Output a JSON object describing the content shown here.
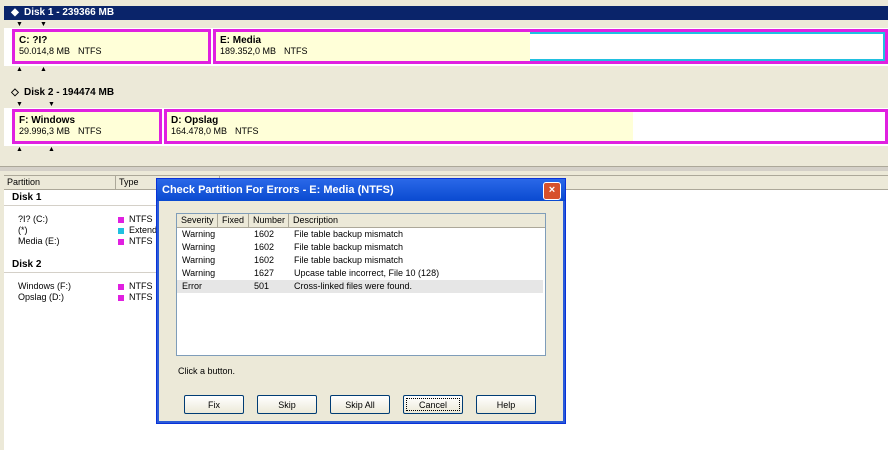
{
  "disk1": {
    "title": "Disk 1 - 239366 MB",
    "partitions": [
      {
        "name": "C:  ?I?",
        "size": "50.014,8 MB",
        "fs": "NTFS"
      },
      {
        "name": "E:  Media",
        "size": "189.352,0 MB",
        "fs": "NTFS"
      }
    ]
  },
  "disk2": {
    "title": "Disk 2 - 194474 MB",
    "partitions": [
      {
        "name": "F:  Windows",
        "size": "29.996,3 MB",
        "fs": "NTFS"
      },
      {
        "name": "D:  Opslag",
        "size": "164.478,0 MB",
        "fs": "NTFS"
      }
    ]
  },
  "list": {
    "columns": [
      "Partition",
      "Type"
    ],
    "groups": [
      {
        "label": "Disk 1",
        "rows": [
          {
            "name": "?I? (C:)",
            "type": "NTFS",
            "color": "#e020e0"
          },
          {
            "name": "(*)",
            "type": "Extended",
            "color": "#20c0e0"
          },
          {
            "name": "Media (E:)",
            "type": "NTFS",
            "color": "#e020e0"
          }
        ]
      },
      {
        "label": "Disk 2",
        "rows": [
          {
            "name": "Windows (F:)",
            "type": "NTFS",
            "color": "#e020e0"
          },
          {
            "name": "Opslag (D:)",
            "type": "NTFS",
            "color": "#e020e0"
          }
        ]
      }
    ]
  },
  "dialog": {
    "title": "Check Partition For Errors - E: Media (NTFS)",
    "close_icon": "×",
    "columns": [
      "Severity",
      "Fixed",
      "Number",
      "Description"
    ],
    "rows": [
      {
        "severity": "Warning",
        "fixed": "",
        "number": "1602",
        "description": "File table backup mismatch"
      },
      {
        "severity": "Warning",
        "fixed": "",
        "number": "1602",
        "description": "File table backup mismatch"
      },
      {
        "severity": "Warning",
        "fixed": "",
        "number": "1602",
        "description": "File table backup mismatch"
      },
      {
        "severity": "Warning",
        "fixed": "",
        "number": "1627",
        "description": "Upcase table incorrect, File 10 (128)"
      },
      {
        "severity": "Error",
        "fixed": "",
        "number": "501",
        "description": "Cross-linked files were found."
      }
    ],
    "message": "Click a button.",
    "buttons": {
      "fix": "Fix",
      "skip": "Skip",
      "skip_all": "Skip All",
      "cancel": "Cancel",
      "help": "Help"
    }
  },
  "colors": {
    "ntfs": "#e020e0",
    "extended": "#20c0e0",
    "selected_border": "#20c0e0",
    "title_bar": "#0a246a"
  }
}
